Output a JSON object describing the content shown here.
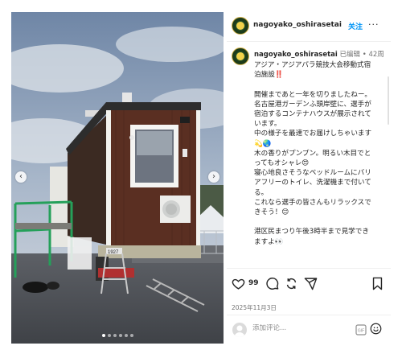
{
  "post": {
    "username": "nagoyako_oshirasetai",
    "follow_label": "关注",
    "more_label": "···",
    "edited_label": "已编辑",
    "separator": "•",
    "age": "42周",
    "caption": "アジア・アジアパラ競技大会移動式宿泊施設‼️\n\n開催まであと一年を切りましたねー。\n名古屋港ガーデンふ頭岸壁に、選手が宿泊するコンテナハウスが展示されています。\n中の様子を最速でお届けしちゃいます💫🌏\n木の香りがプンプン。明るい木目でとってもオシャレ😍\n寝心地良さそうなベッドルームにバリアフリーのトイレ、洗濯機まで付いてる。\nこれなら選手の皆さんもリラックスできそう！😊\n\n港区民まつり午後3時半まで見学できますよ👀",
    "likes": "99",
    "date": "2025年11月3日",
    "comment_placeholder": "添加评论...",
    "carousel": {
      "count": 6,
      "active_index": 0
    },
    "icons": {
      "like": "heart-icon",
      "comment": "comment-icon",
      "repost": "repost-icon",
      "share": "share-icon",
      "save": "bookmark-icon",
      "emoji": "emoji-icon",
      "gif": "gif-icon",
      "prev": "chevron-left-icon",
      "next": "chevron-right-icon"
    },
    "colors": {
      "follow": "#0095f6",
      "muted": "#737373"
    }
  },
  "photo": {
    "container_sign": "1927"
  }
}
